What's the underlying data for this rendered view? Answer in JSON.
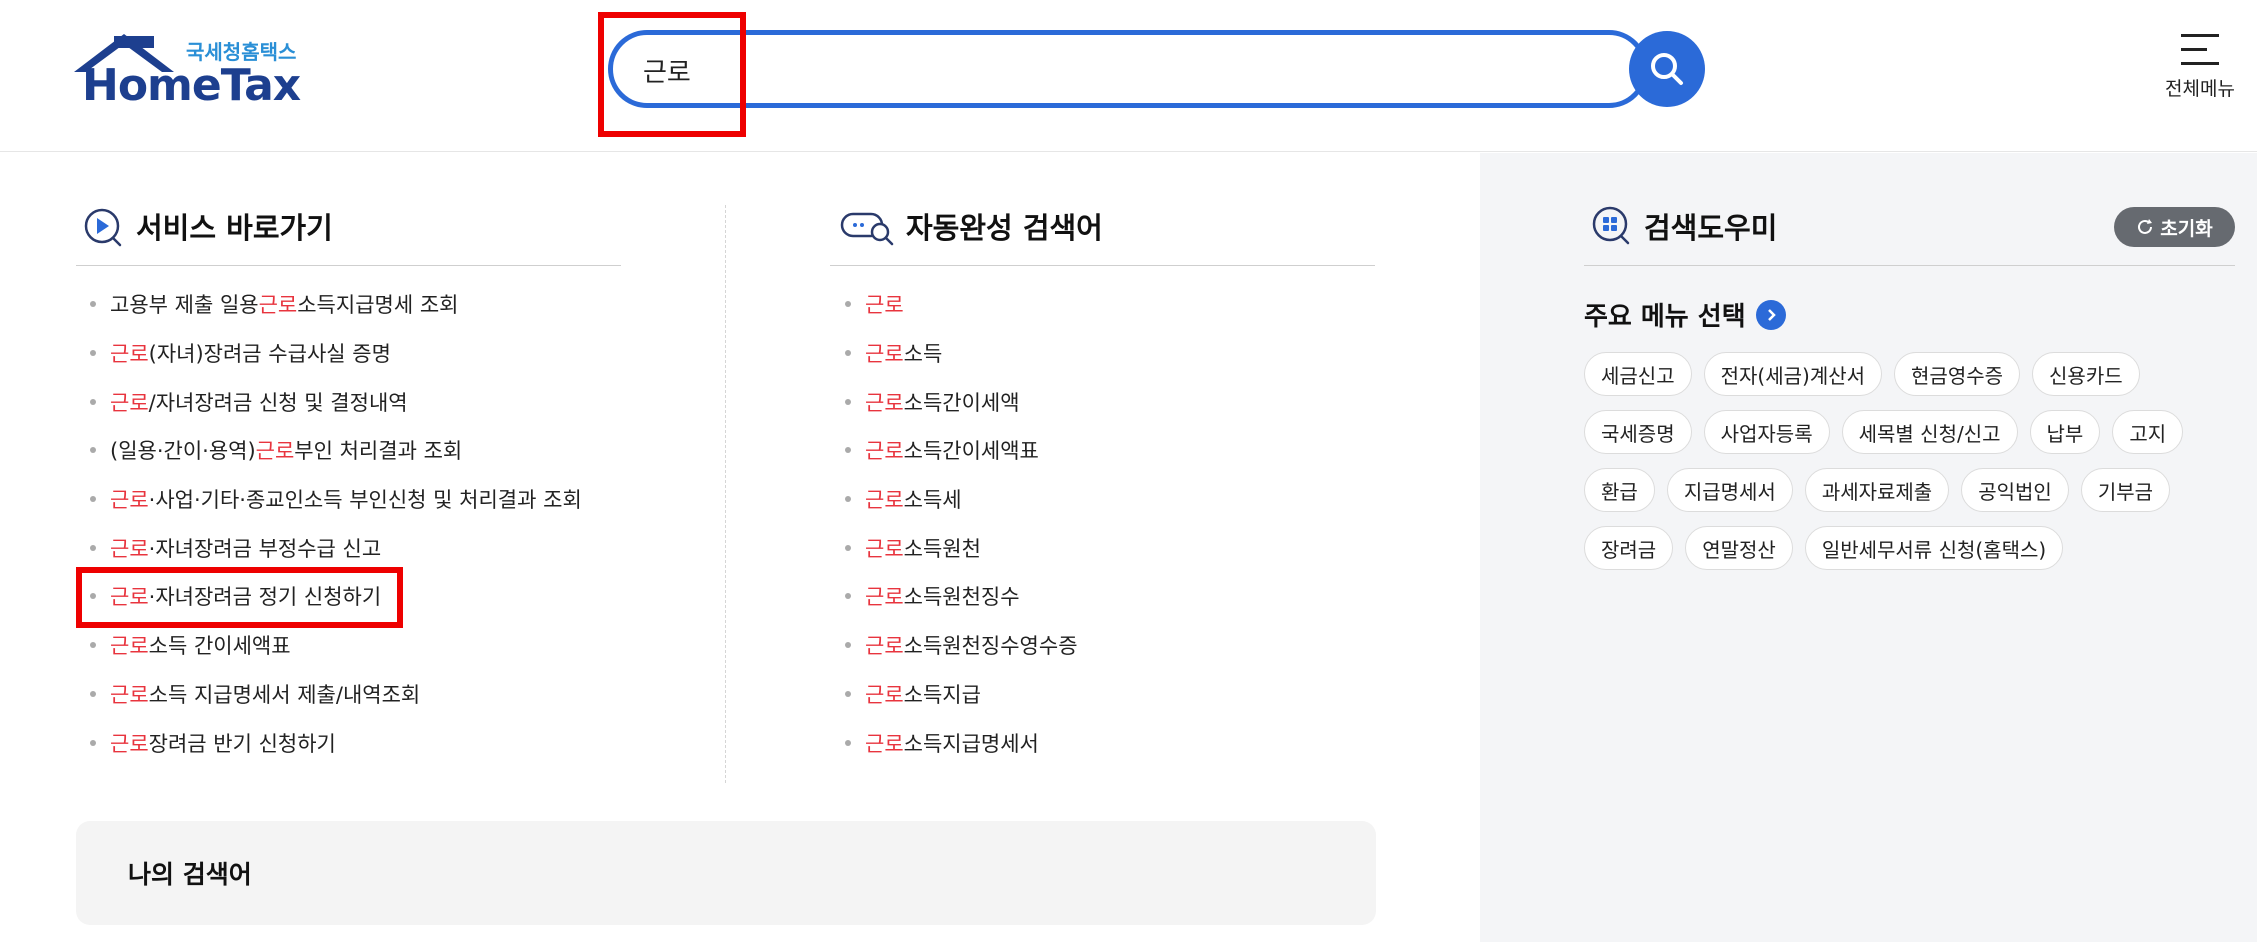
{
  "header": {
    "logo_sub": "국세청홈택스",
    "logo_main": "HomeTax",
    "search_value": "근로",
    "menu_label": "전체메뉴"
  },
  "service_shortcut": {
    "title": "서비스 바로가기",
    "items": [
      {
        "pre": "고용부 제출 일용",
        "kw": "근로",
        "post": "소득지급명세 조회"
      },
      {
        "pre": "",
        "kw": "근로",
        "post": "(자녀)장려금 수급사실 증명"
      },
      {
        "pre": "",
        "kw": "근로",
        "post": "/자녀장려금 신청 및 결정내역"
      },
      {
        "pre": "(일용·간이·용역) ",
        "kw": "근로",
        "post": "부인 처리결과 조회"
      },
      {
        "pre": "",
        "kw": "근로",
        "post": "·사업·기타·종교인소득 부인신청 및 처리결과 조회"
      },
      {
        "pre": "",
        "kw": "근로",
        "post": "·자녀장려금 부정수급 신고"
      },
      {
        "pre": "",
        "kw": "근로",
        "post": "·자녀장려금 정기 신청하기"
      },
      {
        "pre": "",
        "kw": "근로",
        "post": "소득 간이세액표"
      },
      {
        "pre": "",
        "kw": "근로",
        "post": "소득 지급명세서 제출/내역조회"
      },
      {
        "pre": "",
        "kw": "근로",
        "post": "장려금 반기 신청하기"
      }
    ]
  },
  "autocomplete": {
    "title": "자동완성 검색어",
    "items": [
      {
        "kw": "근로",
        "post": ""
      },
      {
        "kw": "근로",
        "post": "소득"
      },
      {
        "kw": "근로",
        "post": "소득간이세액"
      },
      {
        "kw": "근로",
        "post": "소득간이세액표"
      },
      {
        "kw": "근로",
        "post": "소득세"
      },
      {
        "kw": "근로",
        "post": "소득원천"
      },
      {
        "kw": "근로",
        "post": "소득원천징수"
      },
      {
        "kw": "근로",
        "post": "소득원천징수영수증"
      },
      {
        "kw": "근로",
        "post": "소득지급"
      },
      {
        "kw": "근로",
        "post": "소득지급명세서"
      }
    ]
  },
  "my_search": {
    "title": "나의 검색어"
  },
  "search_helper": {
    "title": "검색도우미",
    "reset_label": "초기화",
    "main_menu_title": "주요 메뉴 선택",
    "chips": [
      "세금신고",
      "전자(세금)계산서",
      "현금영수증",
      "신용카드",
      "국세증명",
      "사업자등록",
      "세목별 신청/신고",
      "납부",
      "고지",
      "환급",
      "지급명세서",
      "과세자료제출",
      "공익법인",
      "기부금",
      "장려금",
      "연말정산",
      "일반세무서류 신청(홈택스)"
    ]
  },
  "colors": {
    "accent": "#2b6ad8",
    "keyword": "#e8343e",
    "highlight": "#ee0000"
  }
}
